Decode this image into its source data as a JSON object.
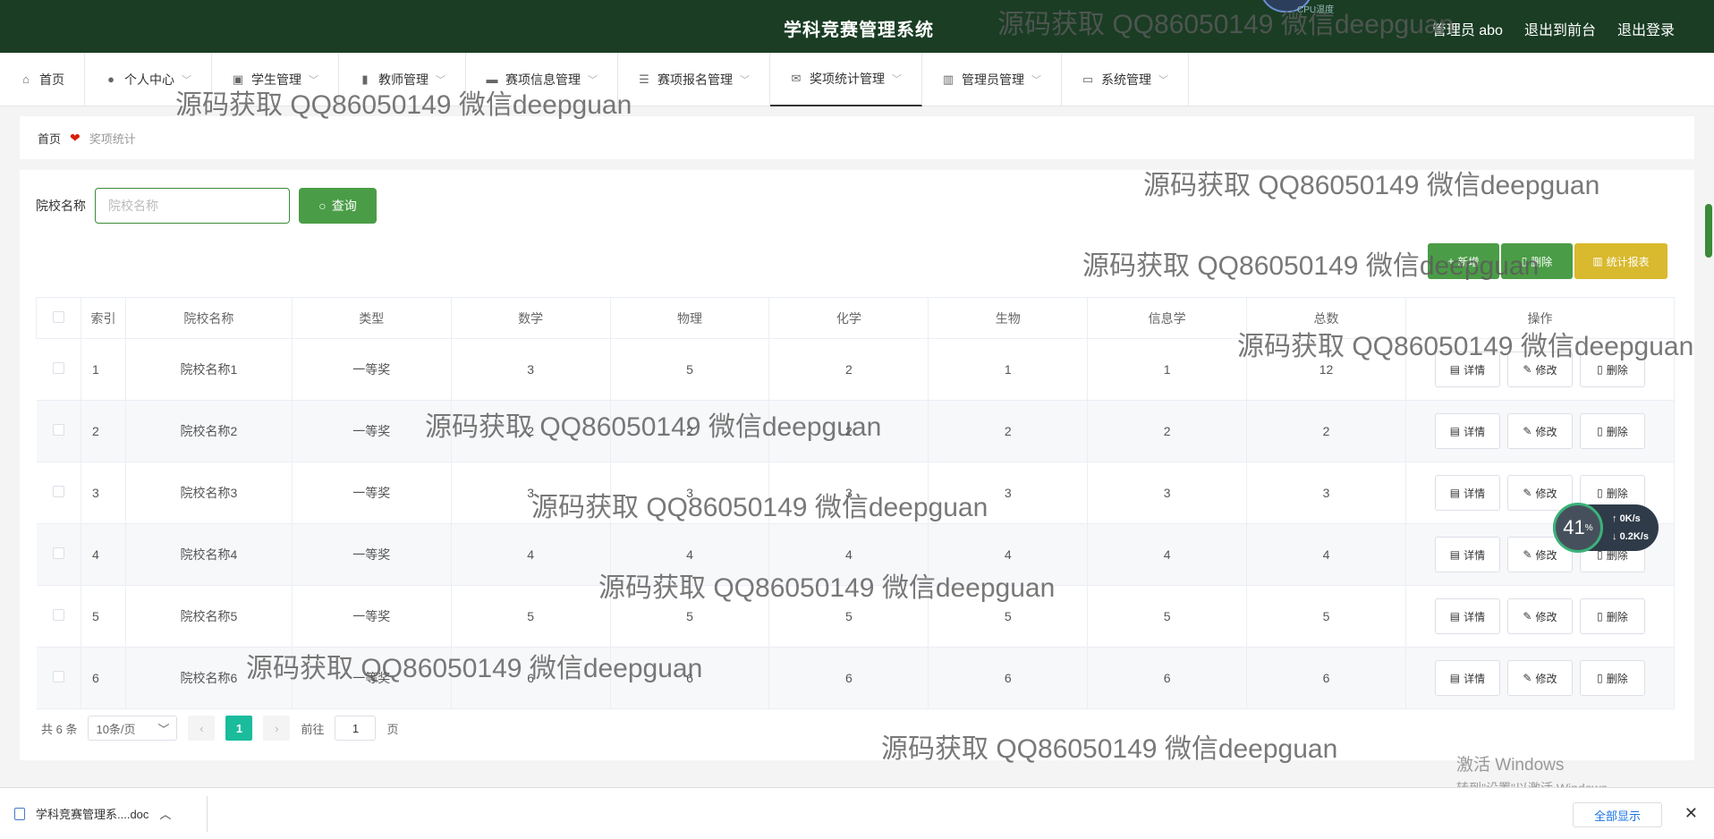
{
  "header": {
    "title": "学科竞赛管理系统",
    "admin": "管理员 abo",
    "to_frontend": "退出到前台",
    "logout": "退出登录",
    "cpu_label": "CPU温度"
  },
  "nav": [
    {
      "label": "首页",
      "icon": "home-icon"
    },
    {
      "label": "个人中心",
      "icon": "user-icon"
    },
    {
      "label": "学生管理",
      "icon": "student-icon"
    },
    {
      "label": "教师管理",
      "icon": "bar-icon"
    },
    {
      "label": "赛项信息管理",
      "icon": "monitor-icon"
    },
    {
      "label": "赛项报名管理",
      "icon": "list-icon"
    },
    {
      "label": "奖项统计管理",
      "icon": "mail-icon"
    },
    {
      "label": "管理员管理",
      "icon": "chart-icon"
    },
    {
      "label": "系统管理",
      "icon": "chat-icon"
    }
  ],
  "breadcrumb": {
    "home": "首页",
    "current": "奖项统计"
  },
  "search": {
    "label": "院校名称",
    "placeholder": "院校名称",
    "button": "查询"
  },
  "actions": {
    "add": "新增",
    "delete": "删除",
    "report": "统计报表"
  },
  "table": {
    "headers": [
      "索引",
      "院校名称",
      "类型",
      "数学",
      "物理",
      "化学",
      "生物",
      "信息学",
      "总数",
      "操作"
    ],
    "rows": [
      [
        "1",
        "院校名称1",
        "一等奖",
        "3",
        "5",
        "2",
        "1",
        "1",
        "12"
      ],
      [
        "2",
        "院校名称2",
        "一等奖",
        "2",
        "2",
        "2",
        "2",
        "2",
        "2"
      ],
      [
        "3",
        "院校名称3",
        "一等奖",
        "3",
        "3",
        "3",
        "3",
        "3",
        "3"
      ],
      [
        "4",
        "院校名称4",
        "一等奖",
        "4",
        "4",
        "4",
        "4",
        "4",
        "4"
      ],
      [
        "5",
        "院校名称5",
        "一等奖",
        "5",
        "5",
        "5",
        "5",
        "5",
        "5"
      ],
      [
        "6",
        "院校名称6",
        "一等奖",
        "6",
        "6",
        "6",
        "6",
        "6",
        "6"
      ]
    ],
    "ops": {
      "detail": "详情",
      "edit": "修改",
      "delete": "删除"
    }
  },
  "pager": {
    "total": "共 6 条",
    "size": "10条/页",
    "page": "1",
    "goto_prefix": "前往",
    "goto_value": "1",
    "goto_suffix": "页"
  },
  "watermark": "源码获取 QQ86050149 微信deepguan",
  "windows": {
    "line1": "激活 Windows",
    "line2": "转到\"设置\"以激活 Windows。"
  },
  "speed": {
    "percent": "41",
    "pct_sign": "%",
    "up": "0K/s",
    "down": "0.2K/s"
  },
  "download": {
    "file": "学科竞赛管理系....doc",
    "show_all": "全部显示"
  },
  "colors": {
    "topbar": "#1a3d24",
    "primary": "#4a9d46",
    "report": "#d9b92d",
    "page_active": "#1abc9c"
  }
}
